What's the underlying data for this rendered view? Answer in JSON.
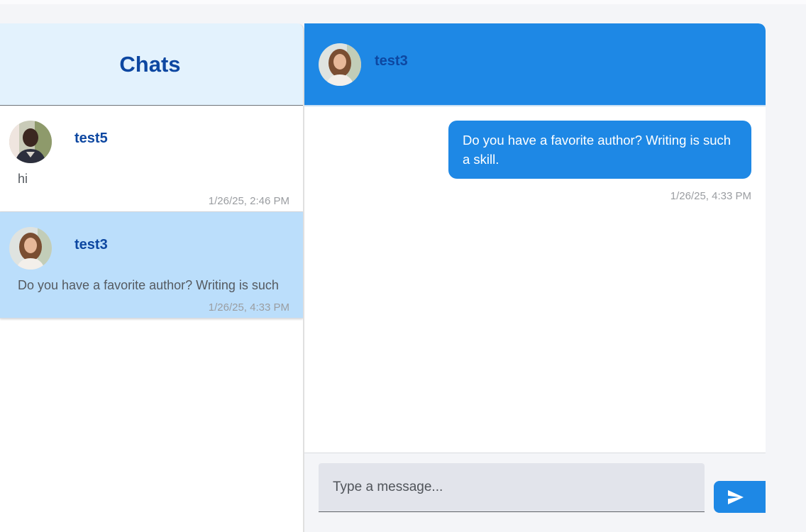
{
  "chat_list": {
    "title": "Chats",
    "items": [
      {
        "name": "test5",
        "preview": "hi",
        "time": "1/26/25, 2:46 PM",
        "avatar": "person-avatar",
        "active": false
      },
      {
        "name": "test3",
        "preview": "Do you have a favorite author? Writing is such",
        "time": "1/26/25, 4:33 PM",
        "avatar": "person-avatar",
        "active": true
      }
    ]
  },
  "conversation": {
    "contact_name": "test3",
    "avatar": "person-avatar",
    "messages": [
      {
        "text": "Do you have a favorite author? Writing is such a skill.",
        "time": "1/26/25, 4:33 PM",
        "outgoing": true
      }
    ]
  },
  "composer": {
    "placeholder": "Type a message...",
    "send_icon": "send-icon"
  },
  "colors": {
    "accent": "#1e88e5",
    "title": "#0d47a1",
    "active_item": "#bbdefb",
    "list_header": "#e3f2fd"
  }
}
